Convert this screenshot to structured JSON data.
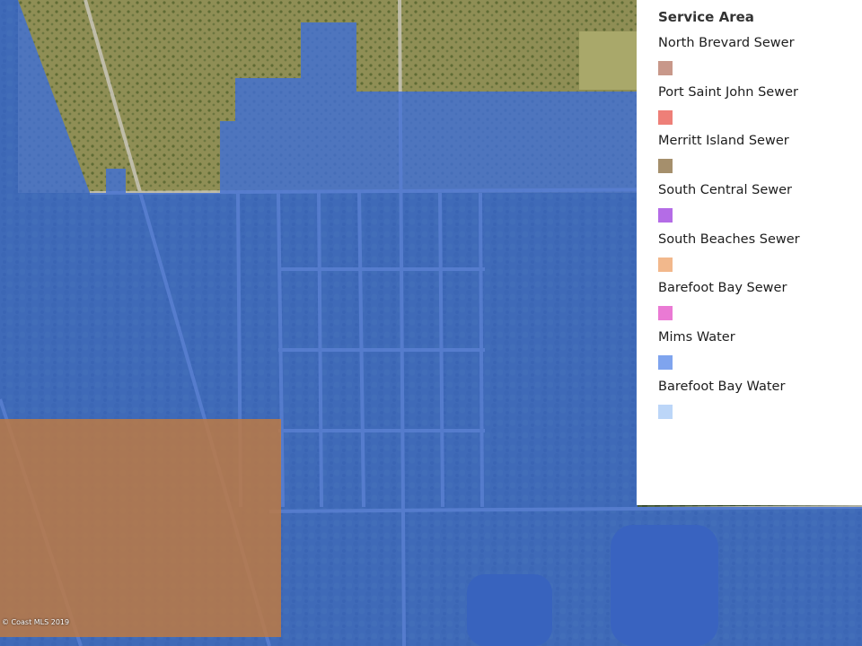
{
  "legend": {
    "title": "Service Area",
    "items": [
      {
        "label": "North Brevard Sewer",
        "color": "#c8988a"
      },
      {
        "label": "Port Saint John Sewer",
        "color": "#ee7f78"
      },
      {
        "label": "Merritt Island Sewer",
        "color": "#a58f6c"
      },
      {
        "label": "South Central Sewer",
        "color": "#b46ce6"
      },
      {
        "label": "South Beaches Sewer",
        "color": "#f2b88c"
      },
      {
        "label": "Barefoot Bay Sewer",
        "color": "#ea7ad4"
      },
      {
        "label": "Mims Water",
        "color": "#7fa4ee"
      },
      {
        "label": "Barefoot Bay Water",
        "color": "#bcd6f8"
      }
    ]
  },
  "map": {
    "layers": [
      {
        "name": "Mims Water",
        "color": "#3f6fd6"
      },
      {
        "name": "North Brevard Sewer",
        "color": "#c27a3e"
      }
    ],
    "base_colors": {
      "vegetation": "#5a6a3a",
      "field": "#8f8e55"
    }
  },
  "copyright": "© Coast MLS 2019"
}
